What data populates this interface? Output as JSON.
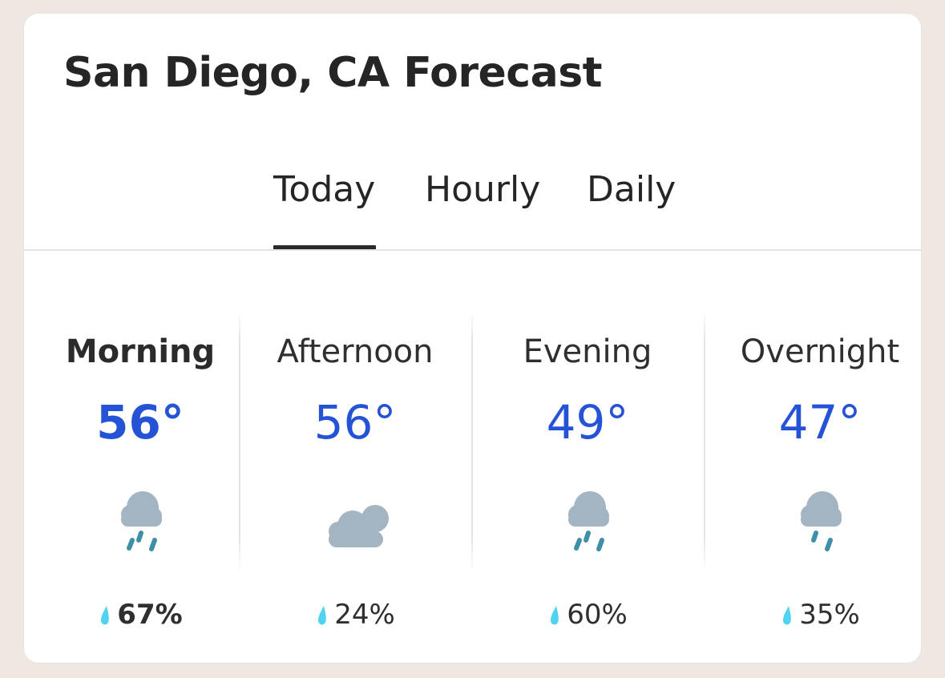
{
  "card": {
    "title": "San Diego, CA Forecast"
  },
  "tabs": {
    "items": [
      {
        "label": "Today",
        "selected": true
      },
      {
        "label": "Hourly",
        "selected": false
      },
      {
        "label": "Daily",
        "selected": false
      }
    ]
  },
  "forecast": {
    "periods": [
      {
        "label": "Morning",
        "temperature": "56°",
        "icon": "rain-cloud-icon",
        "precip": "67%",
        "active": true
      },
      {
        "label": "Afternoon",
        "temperature": "56°",
        "icon": "mostly-cloudy-night-icon",
        "precip": "24%",
        "active": false
      },
      {
        "label": "Evening",
        "temperature": "49°",
        "icon": "rain-cloud-icon",
        "precip": "60%",
        "active": false
      },
      {
        "label": "Overnight",
        "temperature": "47°",
        "icon": "light-rain-cloud-icon",
        "precip": "35%",
        "active": false
      }
    ]
  },
  "colors": {
    "temperature": "#2453d6",
    "rain": "#3f8fa8",
    "cloud": "#a3b4c2",
    "drop": "#4fd3f0"
  }
}
